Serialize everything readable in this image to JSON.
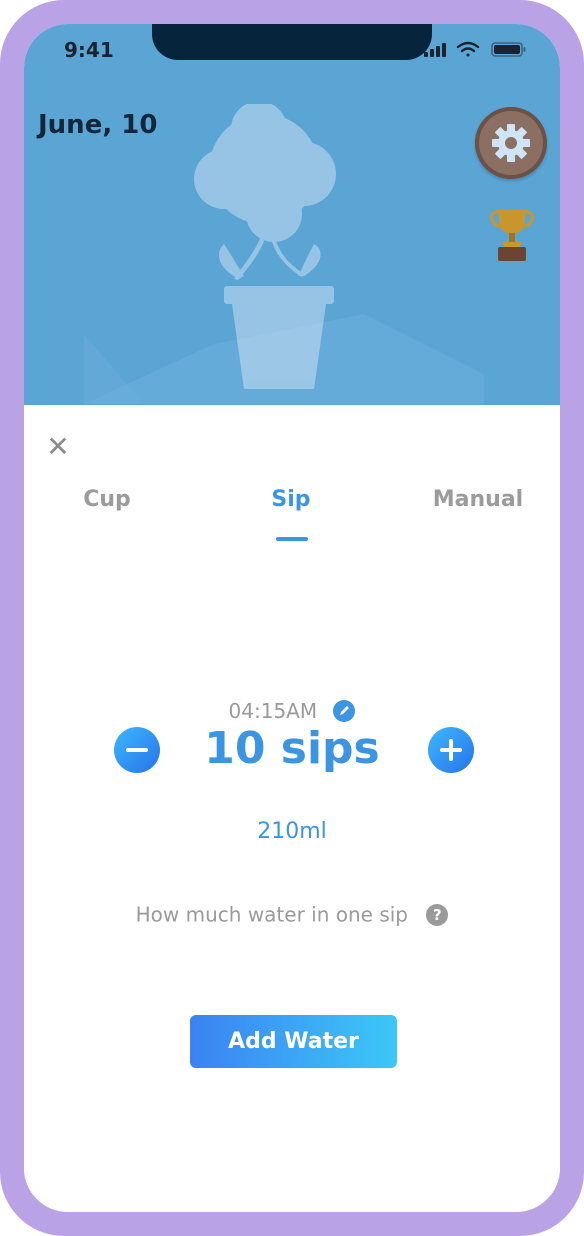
{
  "status_bar": {
    "time": "9:41"
  },
  "header": {
    "date": "June, 10"
  },
  "sheet": {
    "tabs": [
      {
        "label": "Cup",
        "active": false
      },
      {
        "label": "Sip",
        "active": true
      },
      {
        "label": "Manual",
        "active": false
      }
    ],
    "time": "04:15AM",
    "amount": "10 sips",
    "volume": "210ml",
    "hint": "How much water in one sip",
    "add_button": "Add Water"
  },
  "icons": {
    "close": "close-icon",
    "settings": "gear-icon",
    "trophy": "trophy-icon",
    "edit": "pencil-icon",
    "help": "question-icon",
    "minus": "minus-icon",
    "plus": "plus-icon"
  },
  "colors": {
    "device_frame": "#b9a3e6",
    "hero_bg": "#5aa5d4",
    "accent": "#3b95e3",
    "muted_text": "#9a9a9a",
    "button_gradient_start": "#3b82f2",
    "button_gradient_end": "#3cc8f7"
  }
}
